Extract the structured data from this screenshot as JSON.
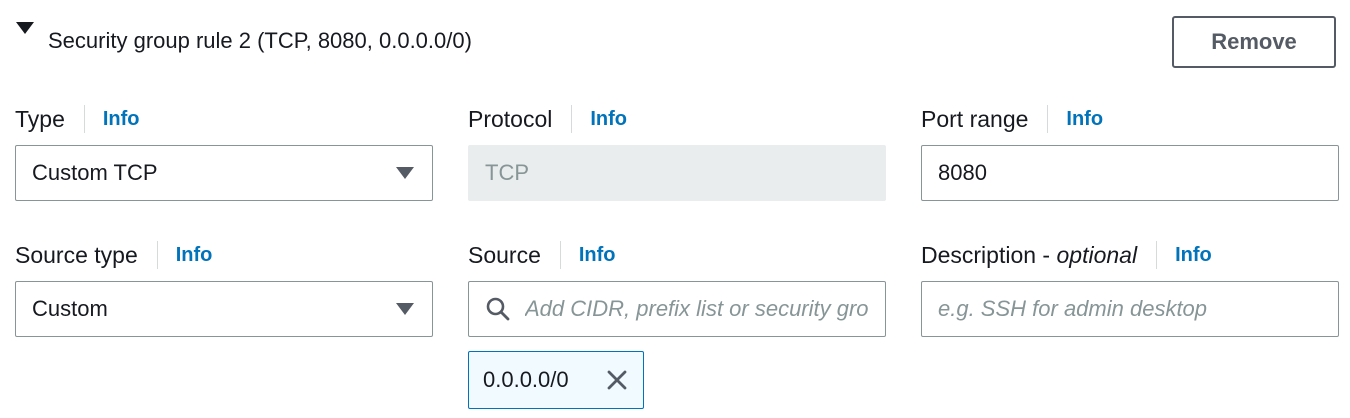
{
  "rule": {
    "title": "Security group rule 2 (TCP, 8080, 0.0.0.0/0)",
    "remove_label": "Remove"
  },
  "fields": {
    "type": {
      "label": "Type",
      "info": "Info",
      "value": "Custom TCP"
    },
    "protocol": {
      "label": "Protocol",
      "info": "Info",
      "value": "TCP"
    },
    "port_range": {
      "label": "Port range",
      "info": "Info",
      "value": "8080"
    },
    "source_type": {
      "label": "Source type",
      "info": "Info",
      "value": "Custom"
    },
    "source": {
      "label": "Source",
      "info": "Info",
      "placeholder": "Add CIDR, prefix list or security group"
    },
    "description": {
      "label": "Description - ",
      "label_optional": "optional",
      "info": "Info",
      "placeholder": "e.g. SSH for admin desktop"
    }
  },
  "source_tokens": [
    {
      "label": "0.0.0.0/0"
    }
  ],
  "icons": {
    "expand": "caret-down-icon",
    "dropdown": "chevron-down-icon",
    "search": "search-icon",
    "token_remove": "close-icon"
  },
  "colors": {
    "text": "#16191f",
    "link": "#0073bb",
    "border": "#879596",
    "disabled_bg": "#eaeded",
    "token_bg": "#f1faff",
    "token_border": "#0073bb"
  }
}
